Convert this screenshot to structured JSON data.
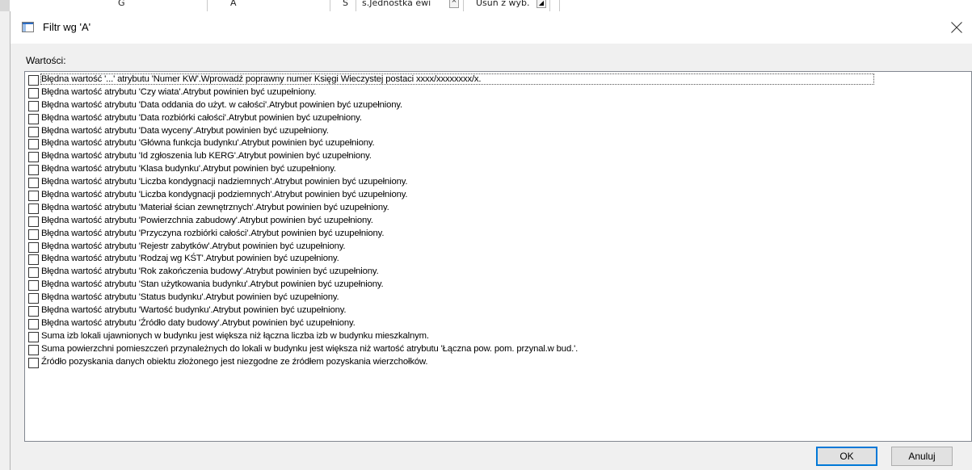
{
  "background_app": {
    "cells": [
      "G",
      "A",
      "S",
      "s.Jednostka ewi",
      "Usuń z wyb."
    ]
  },
  "dialog": {
    "title": "Filtr wg 'A'",
    "values_label": "Wartości:",
    "items": [
      "Błędna wartość '...' atrybutu 'Numer KW'.Wprowadź poprawny numer Księgi Wieczystej postaci xxxx/xxxxxxxx/x.",
      "Błędna wartość atrybutu 'Czy wiata'.Atrybut powinien być uzupełniony.",
      "Błędna wartość atrybutu 'Data oddania do użyt. w całości'.Atrybut powinien być uzupełniony.",
      "Błędna wartość atrybutu 'Data rozbiórki całości'.Atrybut powinien być uzupełniony.",
      "Błędna wartość atrybutu 'Data wyceny'.Atrybut powinien być uzupełniony.",
      "Błędna wartość atrybutu 'Główna funkcja budynku'.Atrybut powinien być uzupełniony.",
      "Błędna wartość atrybutu 'Id zgłoszenia lub KERG'.Atrybut powinien być uzupełniony.",
      "Błędna wartość atrybutu 'Klasa budynku'.Atrybut powinien być uzupełniony.",
      "Błędna wartość atrybutu 'Liczba kondygnacji nadziemnych'.Atrybut powinien być uzupełniony.",
      "Błędna wartość atrybutu 'Liczba kondygnacji podziemnych'.Atrybut powinien być uzupełniony.",
      "Błędna wartość atrybutu 'Materiał ścian zewnętrznych'.Atrybut powinien być uzupełniony.",
      "Błędna wartość atrybutu 'Powierzchnia zabudowy'.Atrybut powinien być uzupełniony.",
      "Błędna wartość atrybutu 'Przyczyna rozbiórki całości'.Atrybut powinien być uzupełniony.",
      "Błędna wartość atrybutu 'Rejestr zabytków'.Atrybut powinien być uzupełniony.",
      "Błędna wartość atrybutu 'Rodzaj wg KŚT'.Atrybut powinien być uzupełniony.",
      "Błędna wartość atrybutu 'Rok zakończenia budowy'.Atrybut powinien być uzupełniony.",
      "Błędna wartość atrybutu 'Stan użytkowania budynku'.Atrybut powinien być uzupełniony.",
      "Błędna wartość atrybutu 'Status budynku'.Atrybut powinien być uzupełniony.",
      "Błędna wartość atrybutu 'Wartość budynku'.Atrybut powinien być uzupełniony.",
      "Błędna wartość atrybutu 'Źródło daty budowy'.Atrybut powinien być uzupełniony.",
      "Suma izb lokali ujawnionych w budynku jest większa niż łączna liczba izb w budynku mieszkalnym.",
      "Suma powierzchni pomieszczeń przynależnych do lokali w budynku jest większa niż wartość atrybutu 'Łączna pow. pom. przynal.w bud.'.",
      "Źródło pozyskania danych obiektu złożonego jest niezgodne ze źródłem pozyskania wierzchołków."
    ],
    "ok_label": "OK",
    "cancel_label": "Anuluj"
  },
  "colors": {
    "accent": "#0078d7",
    "dialog_bg": "#f0f0f0"
  }
}
